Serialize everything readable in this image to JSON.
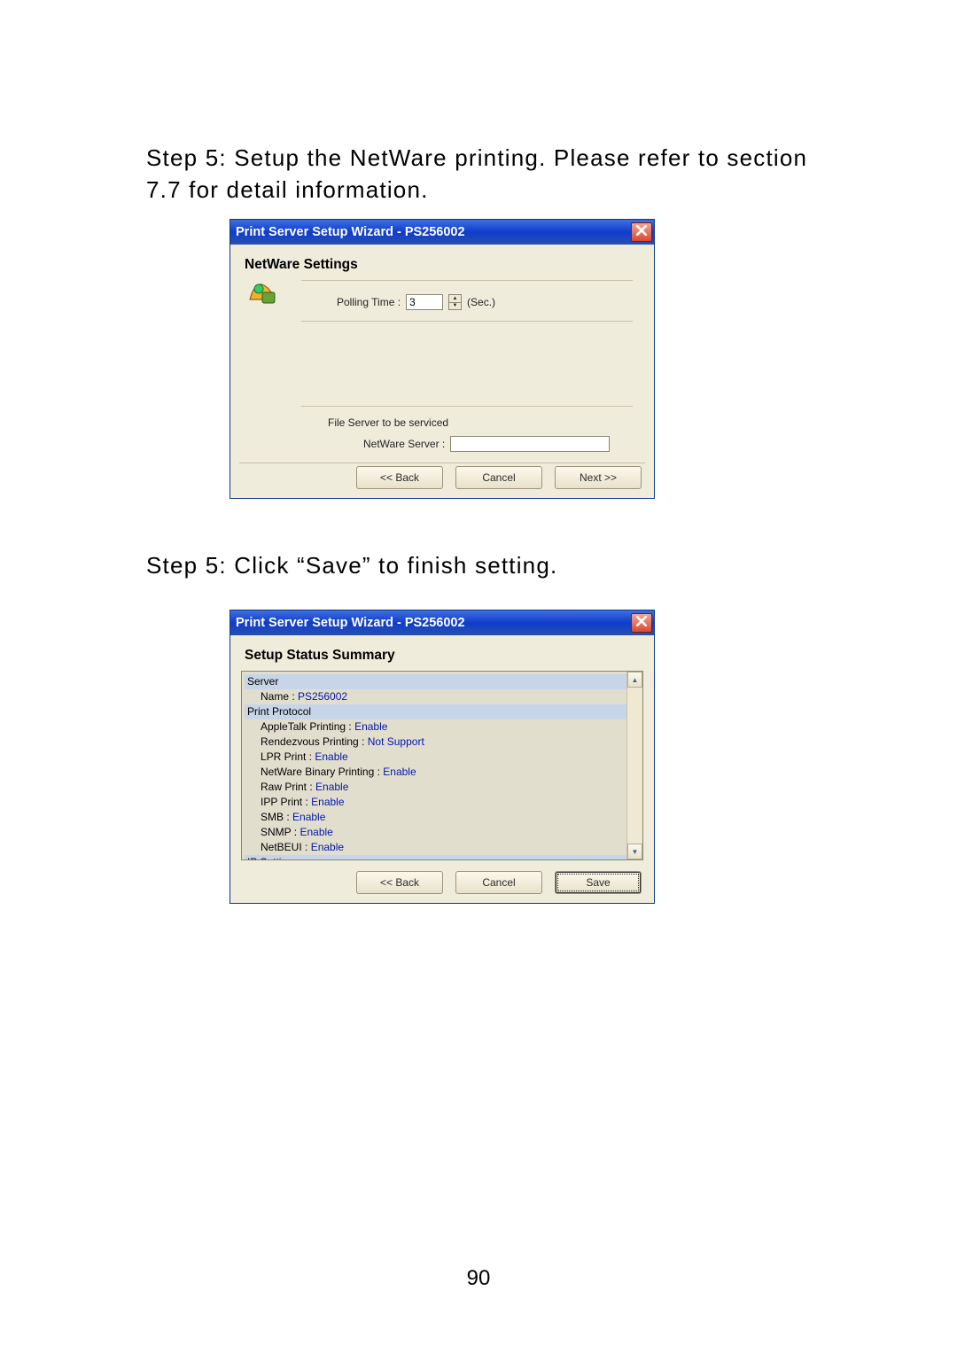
{
  "text": {
    "step_a": "Step 5: Setup the NetWare printing. Please refer to section 7.7 for detail information.",
    "step_b": "Step 5: Click “Save” to finish setting.",
    "page_number": "90"
  },
  "dialog1": {
    "title": "Print Server Setup Wizard - PS256002",
    "heading": "NetWare Settings",
    "polling_label": "Polling Time :",
    "polling_value": "3",
    "polling_unit": "(Sec.)",
    "file_server_label": "File Server to be serviced",
    "netware_server_label": "NetWare Server :",
    "netware_server_value": "",
    "buttons": {
      "back": "<< Back",
      "cancel": "Cancel",
      "next": "Next >>"
    }
  },
  "dialog2": {
    "title": "Print Server Setup Wizard - PS256002",
    "heading": "Setup Status Summary",
    "groups": [
      {
        "label": "Server",
        "items": [
          {
            "key": "Name :",
            "val": "PS256002"
          }
        ]
      },
      {
        "label": "Print Protocol",
        "items": [
          {
            "key": "AppleTalk Printing :",
            "val": "Enable"
          },
          {
            "key": "Rendezvous Printing :",
            "val": "Not Support"
          },
          {
            "key": "LPR Print :",
            "val": "Enable"
          },
          {
            "key": "NetWare Binary Printing :",
            "val": "Enable"
          },
          {
            "key": "Raw Print :",
            "val": "Enable"
          },
          {
            "key": "IPP Print :",
            "val": "Enable"
          },
          {
            "key": "SMB :",
            "val": "Enable"
          },
          {
            "key": "SNMP :",
            "val": "Enable"
          },
          {
            "key": "NetBEUI :",
            "val": "Enable"
          }
        ]
      },
      {
        "label": "IP Settings",
        "items": []
      }
    ],
    "buttons": {
      "back": "<< Back",
      "cancel": "Cancel",
      "save": "Save"
    }
  }
}
